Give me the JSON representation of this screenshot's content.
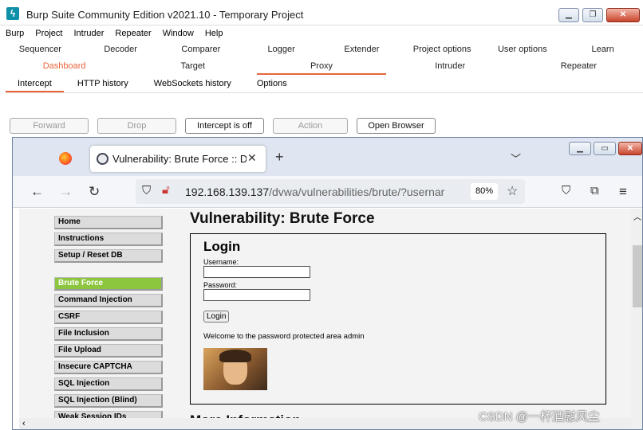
{
  "burp": {
    "title": "Burp Suite Community Edition v2021.10 - Temporary Project",
    "menu": [
      "Burp",
      "Project",
      "Intruder",
      "Repeater",
      "Window",
      "Help"
    ],
    "tools_row1": [
      "Sequencer",
      "Decoder",
      "Comparer",
      "Logger",
      "Extender",
      "Project options",
      "User options",
      "Learn"
    ],
    "tools_row2": [
      "Dashboard",
      "Target",
      "Proxy",
      "Intruder",
      "Repeater"
    ],
    "proxy_tabs": [
      "Intercept",
      "HTTP history",
      "WebSockets history",
      "Options"
    ],
    "intercept_buttons": {
      "forward": "Forward",
      "drop": "Drop",
      "intercept": "Intercept is off",
      "action": "Action",
      "open_browser": "Open Browser"
    },
    "accent_color": "#e8643a"
  },
  "browser": {
    "tab_title": "Vulnerability: Brute Force :: D",
    "url_host": "192.168.139.137",
    "url_path": "/dvwa/vulnerabilities/brute/?usernar",
    "zoom": "80%"
  },
  "dvwa": {
    "menu": [
      "Home",
      "Instructions",
      "Setup / Reset DB",
      "Brute Force",
      "Command Injection",
      "CSRF",
      "File Inclusion",
      "File Upload",
      "Insecure CAPTCHA",
      "SQL Injection",
      "SQL Injection (Blind)",
      "Weak Session IDs"
    ],
    "heading": "Vulnerability: Brute Force",
    "login_title": "Login",
    "username_label": "Username:",
    "password_label": "Password:",
    "login_button": "Login",
    "welcome_text": "Welcome to the password protected area admin",
    "more_info": "More Information",
    "active_color": "#8cc63f"
  },
  "watermark": "CSDN @一杯酒慰风尘"
}
